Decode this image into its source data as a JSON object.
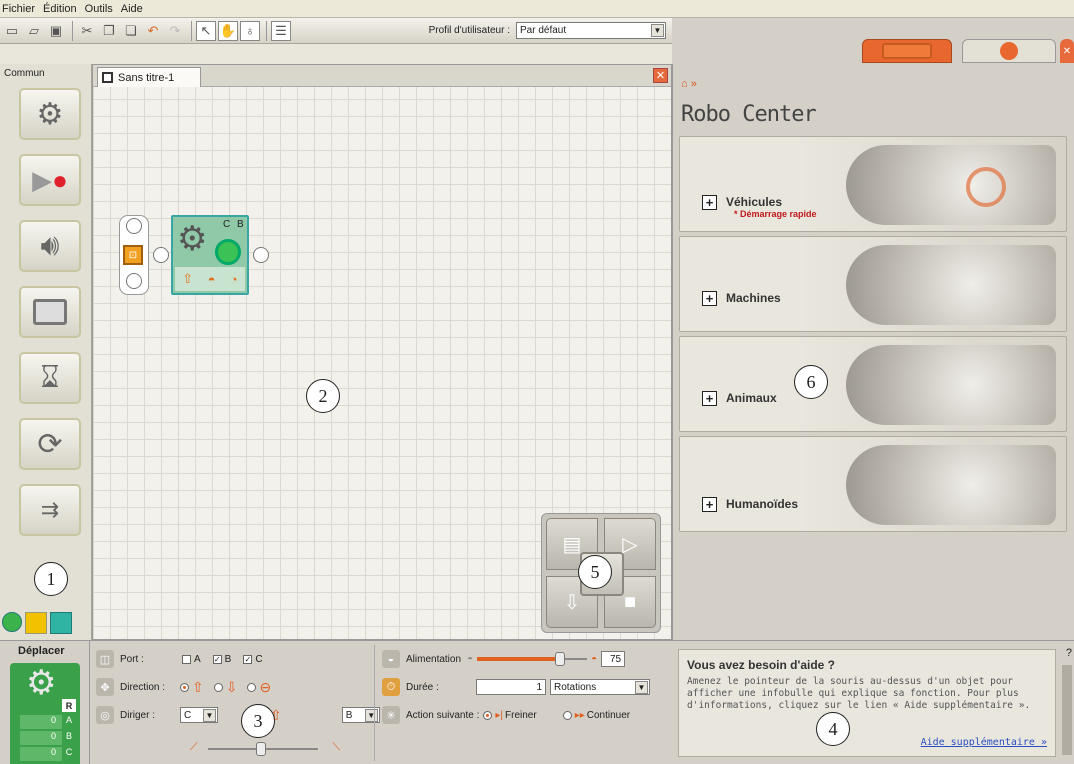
{
  "menu": {
    "items": [
      "Fichier",
      "Édition",
      "Outils",
      "Aide"
    ]
  },
  "toolbar": {
    "profile_label": "Profil d'utilisateur :",
    "profile_value": "Par défaut"
  },
  "palette": {
    "title": "Commun",
    "items": [
      "move-block",
      "record-play-block",
      "sound-block",
      "display-block",
      "wait-block",
      "loop-block",
      "switch-block"
    ]
  },
  "canvas": {
    "tab_title": "Sans titre-1",
    "block": {
      "ports": "C B"
    }
  },
  "robo_center": {
    "title": "Robo Center",
    "cards": [
      {
        "label": "Véhicules",
        "sub": "* Démarrage rapide"
      },
      {
        "label": "Machines",
        "sub": ""
      },
      {
        "label": "Animaux",
        "sub": ""
      },
      {
        "label": "Humanoïdes",
        "sub": ""
      }
    ]
  },
  "config": {
    "title": "Déplacer",
    "port_label": "Port :",
    "ports": [
      "A",
      "B",
      "C"
    ],
    "direction_label": "Direction :",
    "steer_label": "Diriger :",
    "steer_left": "C",
    "steer_right": "B",
    "power_label": "Alimentation",
    "power_value": "75",
    "power_level": 0.75,
    "duration_label": "Durée :",
    "duration_value": "1",
    "duration_unit": "Rotations",
    "next_action_label": "Action suivante :",
    "brake_label": "Freiner",
    "coast_label": "Continuer",
    "side_ports": [
      "A",
      "B",
      "C"
    ],
    "side_values": [
      "0",
      "0",
      "0"
    ],
    "side_r": "R"
  },
  "help": {
    "title": "Vous avez besoin d'aide ?",
    "text": "Amenez le pointeur de la souris au-dessus d'un objet pour afficher une infobulle qui explique sa fonction. Pour plus d'informations, cliquez sur le lien « Aide supplémentaire ».",
    "link": "Aide supplémentaire »"
  },
  "callouts": [
    "1",
    "2",
    "3",
    "4",
    "5",
    "6"
  ]
}
